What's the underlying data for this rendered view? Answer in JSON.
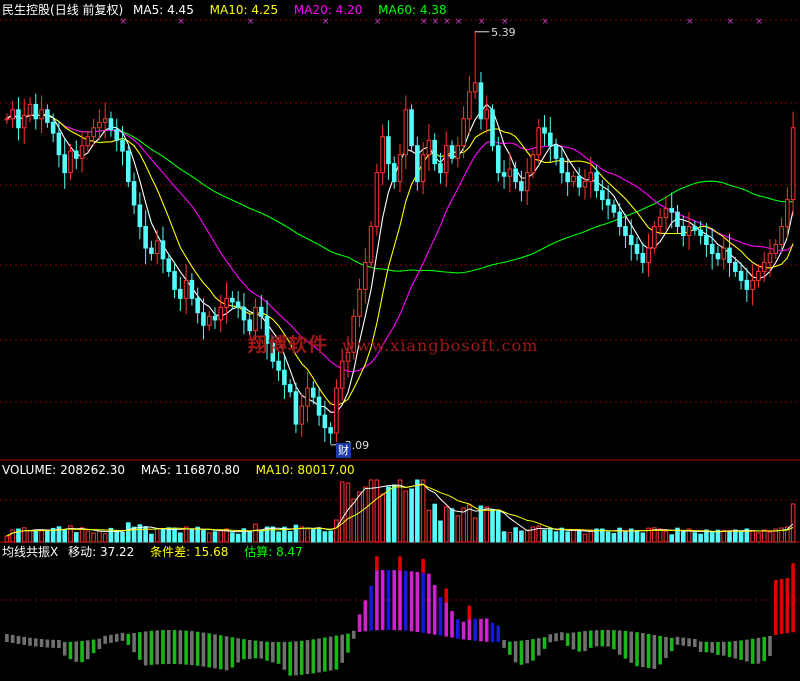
{
  "header": {
    "stock_name": "民生控股",
    "period": "(日线 前复权)",
    "ma5": {
      "label": "MA5:",
      "value": "4.45",
      "color": "#ffffff"
    },
    "ma10": {
      "label": "MA10:",
      "value": "4.25",
      "color": "#ffff00"
    },
    "ma20": {
      "label": "MA20:",
      "value": "4.20",
      "color": "#ff00ff"
    },
    "ma60": {
      "label": "MA60:",
      "value": "4.38",
      "color": "#00ff00"
    }
  },
  "volume_header": {
    "volume": {
      "label": "VOLUME:",
      "value": "208262.30"
    },
    "ma5": {
      "label": "MA5:",
      "value": "116870.80"
    },
    "ma10": {
      "label": "MA10:",
      "value": "80017.00"
    }
  },
  "indicator_header": {
    "name": "均线共振X",
    "move": {
      "label": "移动:",
      "value": "37.22"
    },
    "diff": {
      "label": "条件差:",
      "value": "15.68"
    },
    "est": {
      "label": "估算:",
      "value": "8.47"
    }
  },
  "annotations": {
    "high_label": "5.39",
    "low_label": "3.09",
    "finance_badge": "财",
    "watermark_cn": "翔博软件",
    "watermark_url": "www.xiangbosoft.com"
  },
  "colors": {
    "up": "#ff3232",
    "down": "#54fcfc",
    "grid": "#8b0000",
    "ind_red": "#e00000",
    "ind_magenta": "#d020d0",
    "ind_blue": "#1818d8",
    "ind_green": "#18b818",
    "ind_gray": "#707070",
    "ind_pink": "#e080e0",
    "marker": "#d040d0"
  },
  "chart_data": {
    "type": "candlestick",
    "price_axis_range": [
      3.0,
      5.45
    ],
    "high": 5.39,
    "low": 3.09,
    "close_series": [
      4.9,
      4.95,
      4.85,
      4.92,
      4.98,
      4.9,
      4.95,
      4.88,
      4.82,
      4.7,
      4.6,
      4.72,
      4.68,
      4.75,
      4.8,
      4.85,
      4.88,
      4.9,
      4.84,
      4.78,
      4.72,
      4.55,
      4.42,
      4.3,
      4.18,
      4.15,
      4.22,
      4.12,
      4.05,
      3.95,
      3.9,
      4.0,
      3.9,
      3.82,
      3.75,
      3.8,
      3.78,
      3.85,
      3.9,
      3.88,
      3.85,
      3.78,
      3.72,
      3.85,
      3.8,
      3.65,
      3.55,
      3.5,
      3.42,
      3.38,
      3.2,
      3.3,
      3.4,
      3.35,
      3.25,
      3.18,
      3.15,
      3.4,
      3.55,
      3.6,
      3.8,
      3.95,
      4.1,
      4.3,
      4.6,
      4.8,
      4.65,
      4.55,
      4.7,
      4.95,
      4.75,
      4.55,
      4.7,
      4.78,
      4.65,
      4.6,
      4.75,
      4.68,
      4.75,
      4.9,
      5.05,
      5.1,
      4.9,
      4.95,
      4.75,
      4.6,
      4.58,
      4.62,
      4.55,
      4.5,
      4.6,
      4.7,
      4.85,
      4.82,
      4.75,
      4.68,
      4.6,
      4.55,
      4.58,
      4.52,
      4.55,
      4.6,
      4.5,
      4.45,
      4.42,
      4.38,
      4.3,
      4.25,
      4.2,
      4.15,
      4.1,
      4.18,
      4.3,
      4.35,
      4.4,
      4.38,
      4.3,
      4.25,
      4.3,
      4.28,
      4.25,
      4.2,
      4.15,
      4.12,
      4.18,
      4.1,
      4.05,
      4.0,
      3.95,
      4.0,
      4.05,
      4.1,
      4.15,
      4.2,
      4.3,
      4.45,
      4.85
    ],
    "series": [
      {
        "name": "MA5",
        "value": 4.45
      },
      {
        "name": "MA10",
        "value": 4.25
      },
      {
        "name": "MA20",
        "value": 4.2
      },
      {
        "name": "MA60",
        "value": 4.38
      }
    ],
    "volume": {
      "last": 208262.3,
      "ma5": 116870.8,
      "ma10": 80017.0
    },
    "indicator": {
      "move": 37.22,
      "diff": 15.68,
      "estimate": 8.47
    }
  }
}
